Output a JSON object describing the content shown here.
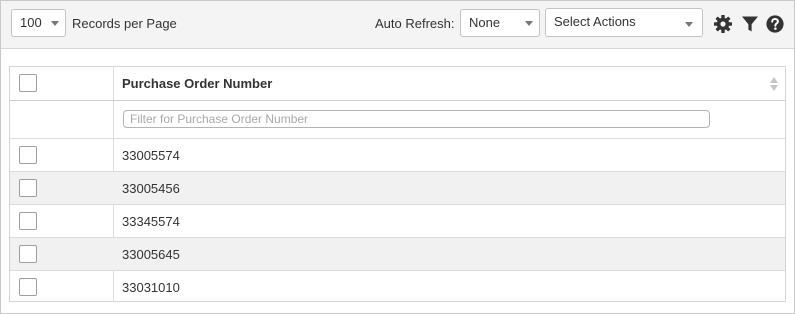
{
  "toolbar": {
    "records_per_page_value": "100",
    "records_per_page_label": "Records per Page",
    "auto_refresh_label": "Auto Refresh:",
    "auto_refresh_value": "None",
    "select_actions_label": "Select Actions",
    "icons": [
      "gear-icon",
      "filter-icon",
      "help-icon"
    ]
  },
  "table": {
    "columns": [
      {
        "label": "Purchase Order Number",
        "filter_placeholder": "Filter for Purchase Order Number"
      }
    ],
    "rows": [
      {
        "purchase_order_number": "33005574",
        "checked": false
      },
      {
        "purchase_order_number": "33005456",
        "checked": false
      },
      {
        "purchase_order_number": "33345574",
        "checked": false
      },
      {
        "purchase_order_number": "33005645",
        "checked": false
      },
      {
        "purchase_order_number": "33031010",
        "checked": false
      }
    ]
  }
}
